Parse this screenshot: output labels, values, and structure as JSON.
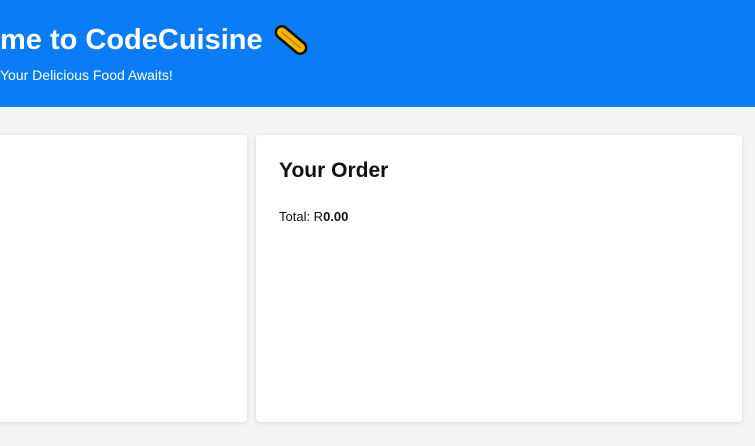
{
  "header": {
    "title": "me to CodeCuisine",
    "title_icon": "hotdog-icon",
    "subtitle": "Your Delicious Food Awaits!",
    "background_color": "#0a7cf8"
  },
  "order": {
    "heading": "Your Order",
    "total_label": "Total: R",
    "total_amount": "0.00"
  }
}
